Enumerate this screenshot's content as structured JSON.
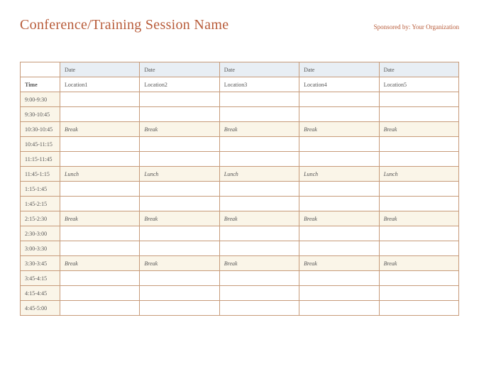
{
  "header": {
    "title": "Conference/Training Session Name",
    "sponsor": "Sponsored by: Your Organization"
  },
  "table": {
    "corner": "",
    "time_label": "Time",
    "date_headers": [
      "Date",
      "Date",
      "Date",
      "Date",
      "Date"
    ],
    "locations": [
      "Location1",
      "Location2",
      "Location3",
      "Location4",
      "Location5"
    ],
    "rows": [
      {
        "time": "9:00-9:30",
        "cells": [
          "",
          "",
          "",
          "",
          ""
        ],
        "highlight": false
      },
      {
        "time": "9:30-10:45",
        "cells": [
          "",
          "",
          "",
          "",
          ""
        ],
        "highlight": false
      },
      {
        "time": "10:30-10:45",
        "cells": [
          "Break",
          "Break",
          "Break",
          "Break",
          "Break"
        ],
        "highlight": true
      },
      {
        "time": "10:45-11:15",
        "cells": [
          "",
          "",
          "",
          "",
          ""
        ],
        "highlight": false
      },
      {
        "time": "11:15-11:45",
        "cells": [
          "",
          "",
          "",
          "",
          ""
        ],
        "highlight": false
      },
      {
        "time": "11:45-1:15",
        "cells": [
          "Lunch",
          "Lunch",
          "Lunch",
          "Lunch",
          "Lunch"
        ],
        "highlight": true
      },
      {
        "time": "1:15-1:45",
        "cells": [
          "",
          "",
          "",
          "",
          ""
        ],
        "highlight": false
      },
      {
        "time": "1:45-2:15",
        "cells": [
          "",
          "",
          "",
          "",
          ""
        ],
        "highlight": false
      },
      {
        "time": "2:15-2:30",
        "cells": [
          "Break",
          "Break",
          "Break",
          "Break",
          "Break"
        ],
        "highlight": true
      },
      {
        "time": "2:30-3:00",
        "cells": [
          "",
          "",
          "",
          "",
          ""
        ],
        "highlight": false
      },
      {
        "time": "3:00-3:30",
        "cells": [
          "",
          "",
          "",
          "",
          ""
        ],
        "highlight": false
      },
      {
        "time": "3:30-3:45",
        "cells": [
          "Break",
          "Break",
          "Break",
          "Break",
          "Break"
        ],
        "highlight": true
      },
      {
        "time": "3:45-4:15",
        "cells": [
          "",
          "",
          "",
          "",
          ""
        ],
        "highlight": false
      },
      {
        "time": "4:15-4:45",
        "cells": [
          "",
          "",
          "",
          "",
          ""
        ],
        "highlight": false
      },
      {
        "time": "4:45-5:00",
        "cells": [
          "",
          "",
          "",
          "",
          ""
        ],
        "highlight": false
      }
    ]
  }
}
